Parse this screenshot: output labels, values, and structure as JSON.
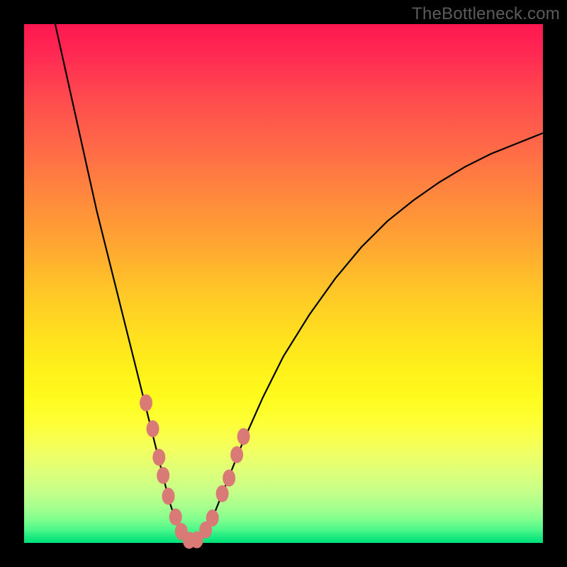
{
  "watermark": "TheBottleneck.com",
  "chart_data": {
    "type": "line",
    "title": "",
    "xlabel": "",
    "ylabel": "",
    "xlim": [
      0,
      100
    ],
    "ylim": [
      0,
      100
    ],
    "grid": false,
    "series": [
      {
        "name": "bottleneck-curve",
        "x": [
          6,
          8,
          10,
          12,
          14,
          16,
          18,
          20,
          22,
          24,
          26,
          27,
          28,
          29,
          30,
          31,
          32,
          33,
          34,
          36,
          38,
          42,
          46,
          50,
          55,
          60,
          65,
          70,
          75,
          80,
          85,
          90,
          95,
          100
        ],
        "y": [
          100,
          91,
          82,
          73,
          64,
          56,
          48,
          40,
          32,
          24,
          16,
          12,
          8,
          5,
          2,
          0.5,
          0,
          0.3,
          1,
          4,
          9,
          19,
          28,
          36,
          44,
          51,
          57,
          62,
          66,
          69.5,
          72.5,
          75,
          77,
          79
        ]
      }
    ],
    "markers": {
      "name": "highlight-points",
      "x": [
        23.5,
        24.8,
        26.0,
        26.8,
        27.8,
        29.2,
        30.3,
        31.8,
        33.3,
        35.0,
        36.3,
        38.2,
        39.5,
        41.0,
        42.3
      ],
      "y": [
        27,
        22,
        16.5,
        13,
        9,
        5,
        2.2,
        0.5,
        0.6,
        2.5,
        4.8,
        9.5,
        12.5,
        17,
        20.5
      ]
    },
    "gradient_stops": [
      {
        "pos": 0,
        "color": "#ff1750"
      },
      {
        "pos": 50,
        "color": "#ffc827"
      },
      {
        "pos": 75,
        "color": "#feff38"
      },
      {
        "pos": 100,
        "color": "#00e079"
      }
    ]
  }
}
